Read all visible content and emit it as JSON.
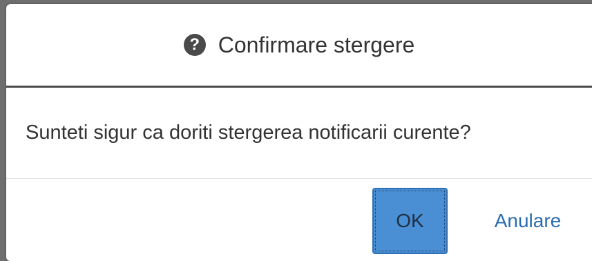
{
  "dialog": {
    "title": "Confirmare stergere",
    "header_icon": "question-circle-icon",
    "message": "Sunteti sigur ca doriti stergerea notificarii curente?",
    "ok_label": "OK",
    "cancel_label": "Anulare"
  },
  "colors": {
    "backdrop": "#6f6f6f",
    "accent_button": "#4a8fd4",
    "link_text": "#2a6cb0",
    "icon": "#4a4a4a"
  }
}
